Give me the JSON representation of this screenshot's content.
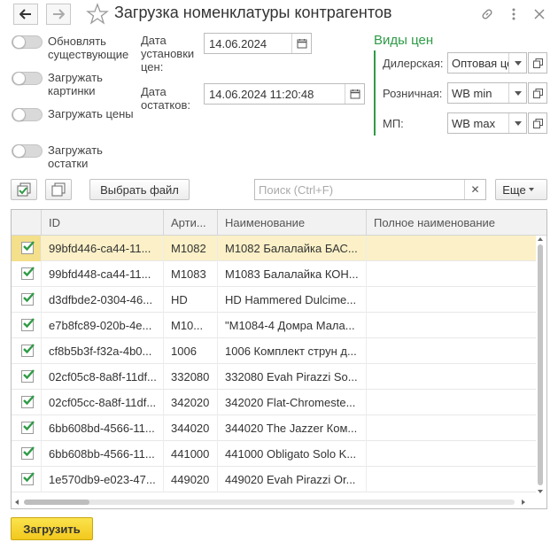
{
  "title": "Загрузка номенклатуры контрагентов",
  "toggles": [
    {
      "label": "Обновлять существующие"
    },
    {
      "label": "Загружать картинки"
    },
    {
      "label": "Загружать цены"
    },
    {
      "label": "Загружать остатки"
    }
  ],
  "dates": {
    "install_label": "Дата установки цен:",
    "install_value": "14.06.2024",
    "stock_label": "Дата остатков:",
    "stock_value": "14.06.2024 11:20:48"
  },
  "prices": {
    "title": "Виды цен",
    "dealer_label": "Дилерская:",
    "dealer_value": "Оптовая це",
    "retail_label": "Розничная:",
    "retail_value": "WB min",
    "mp_label": "МП:",
    "mp_value": "WB max"
  },
  "toolbar": {
    "choose_file": "Выбрать файл",
    "search_placeholder": "Поиск (Ctrl+F)",
    "more": "Еще"
  },
  "table": {
    "columns": [
      "ID",
      "Арти...",
      "Наименование",
      "Полное наименование"
    ],
    "rows": [
      {
        "id": "99bfd446-ca44-11...",
        "art": "M1082",
        "name": "M1082 Балалайка БАС...",
        "full": "",
        "checked": true
      },
      {
        "id": "99bfd448-ca44-11...",
        "art": "M1083",
        "name": "M1083 Балалайка КОН...",
        "full": "",
        "checked": true
      },
      {
        "id": "d3dfbde2-0304-46...",
        "art": "HD",
        "name": "HD Hammered Dulcime...",
        "full": "",
        "checked": true
      },
      {
        "id": "e7b8fc89-020b-4e...",
        "art": "M10...",
        "name": "\"M1084-4 Домра Мала...",
        "full": "",
        "checked": true
      },
      {
        "id": "cf8b5b3f-f32a-4b0...",
        "art": "1006",
        "name": "1006 Комплект струн д...",
        "full": "",
        "checked": true
      },
      {
        "id": "02cf05c8-8a8f-11df...",
        "art": "332080",
        "name": "332080 Evah Pirazzi So...",
        "full": "",
        "checked": true
      },
      {
        "id": "02cf05cc-8a8f-11df...",
        "art": "342020",
        "name": "342020 Flat-Chromeste...",
        "full": "",
        "checked": true
      },
      {
        "id": "6bb608bd-4566-11...",
        "art": "344020",
        "name": "344020 The Jazzer Ком...",
        "full": "",
        "checked": true
      },
      {
        "id": "6bb608bb-4566-11...",
        "art": "441000",
        "name": "441000 Obligato Solo K...",
        "full": "",
        "checked": true
      },
      {
        "id": "1e570db9-e023-47...",
        "art": "449020",
        "name": "449020 Evah Pirazzi Or...",
        "full": "",
        "checked": true
      }
    ]
  },
  "load_button": "Загрузить",
  "colors": {
    "accent_green": "#2e9b46",
    "primary_yellow": "#f2c81d",
    "selected_row": "#fbf0c7"
  }
}
